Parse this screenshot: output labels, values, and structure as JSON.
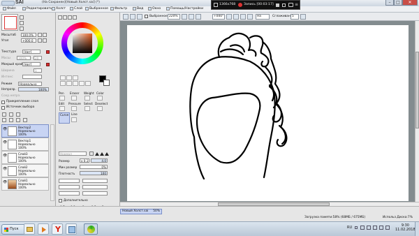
{
  "titlebar": {
    "app": "SAI",
    "title": "(На Сохранен)[Новый Холст.sai] (*)"
  },
  "menubar": {
    "items": [
      "Файл",
      "Редактировать",
      "Холст",
      "Слой",
      "Выбранное",
      "Фильтр",
      "Вид",
      "Окно",
      "Помощь/Настройки"
    ]
  },
  "recorder": {
    "resolution": "1366x768",
    "rec_label": "Запись [00:03:17]"
  },
  "toolbar": {
    "zoom_value": "+000*",
    "stabilizer_label": "Выбранное",
    "percent": "220%",
    "zoom2": "+000°",
    "angle_label": "На",
    "smoothing_label": "Сглаживание",
    "smoothing_value": "5"
  },
  "left_panel": {
    "scale_label": "Масштаб",
    "scale_value": "100.0%",
    "angle_label": "Угол",
    "angle_value": "+000.0",
    "texture_label": "Текстура",
    "texture_value": "[Нет]",
    "scale2_label": "Масш",
    "scale2_value": "100%",
    "val20": "20",
    "wet_label": "Мокрый край",
    "wet_value": "[Нет]",
    "width_label": "Ширина",
    "width_value": "1",
    "intensity_label": "Интенс",
    "mode_label": "Режим",
    "mode_value": "Нормально",
    "opacity_label": "Непрозр.",
    "opacity_value": "100%",
    "preserve_opacity": "Сохр.непрз.",
    "clip_label": "Прикрепление слоя",
    "source_label": "Источник выбора",
    "layers": [
      {
        "name": "Вектор2",
        "mode": "Нормально",
        "opacity": "100%"
      },
      {
        "name": "Вектор1",
        "mode": "Нормально",
        "opacity": "100%"
      },
      {
        "name": "Слой3",
        "mode": "Нормально",
        "opacity": "100%"
      },
      {
        "name": "Слой2",
        "mode": "Нормально",
        "opacity": "100%"
      },
      {
        "name": "Слой1",
        "mode": "Нормально",
        "opacity": "100%"
      }
    ]
  },
  "tool_panel": {
    "tool_labels": [
      "Pen",
      "Eraser",
      "Weight",
      "Color",
      "Edit",
      "Pressure",
      "Select",
      "Deselect",
      "Curve",
      "Line"
    ],
    "mode_label": "Нормал",
    "size_label": "Размер",
    "size_mult": "x 0.1",
    "size_value": "4.0",
    "min_size_label": "Мин размер",
    "min_size_value": "0%",
    "density_label": "Плотность",
    "density_value": "100",
    "advanced_label": "Дополнительно",
    "brush_sizes": [
      "0.7",
      "0.8",
      "1",
      "1.5",
      "2"
    ]
  },
  "statusbar": {
    "doc_tab": "Новый Холст.sai",
    "doc_zoom": "50%",
    "memory": "Загрузка памяти:58% (68МБ / 675МБ)",
    "disk": "Использ.Диска:7%"
  },
  "taskbar": {
    "start_label": "Пуск",
    "lang": "RU",
    "time": "9:30",
    "date": "11.02.2018"
  },
  "colors": {
    "accent": "#7a8fc8",
    "selected_layer": "#c8d4f3",
    "paper": "#ffffff",
    "canvas_bg": "#838c8f"
  }
}
